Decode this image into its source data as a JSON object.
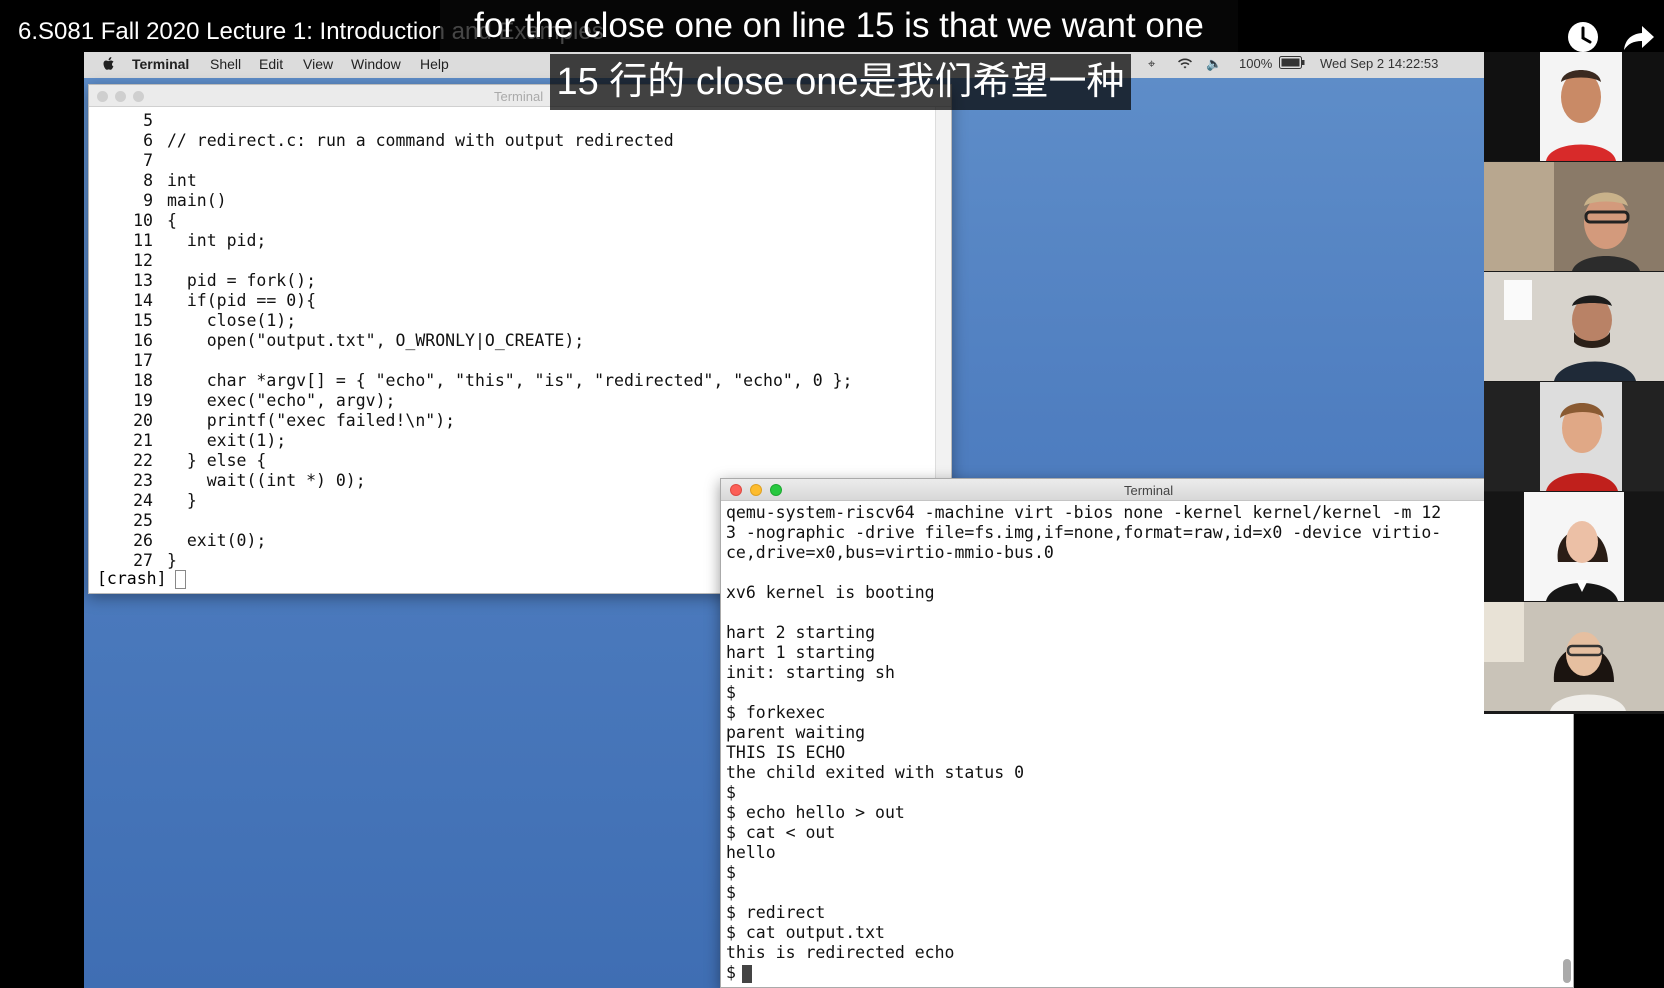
{
  "video": {
    "title": "6.S081 Fall 2020 Lecture 1: Introduction and Examples",
    "icons": [
      "clock-icon",
      "share-icon"
    ]
  },
  "captions": {
    "english": "for the close one on line 15 is that we want one",
    "chinese": "15 行的 close one是我们希望一种"
  },
  "menubar": {
    "apple_icon": "apple-icon",
    "app_name": "Terminal",
    "items": [
      "Shell",
      "Edit",
      "View",
      "Window",
      "Help"
    ],
    "battery": "100%",
    "datetime": "Wed Sep 2  14:22:53"
  },
  "editor": {
    "title": "Terminal",
    "lines": [
      {
        "num": "5",
        "text": ""
      },
      {
        "num": "6",
        "text": "// redirect.c: run a command with output redirected"
      },
      {
        "num": "7",
        "text": ""
      },
      {
        "num": "8",
        "text": "int"
      },
      {
        "num": "9",
        "text": "main()"
      },
      {
        "num": "10",
        "text": "{"
      },
      {
        "num": "11",
        "text": "  int pid;"
      },
      {
        "num": "12",
        "text": ""
      },
      {
        "num": "13",
        "text": "  pid = fork();"
      },
      {
        "num": "14",
        "text": "  if(pid == 0){"
      },
      {
        "num": "15",
        "text": "    close(1);"
      },
      {
        "num": "16",
        "text": "    open(\"output.txt\", O_WRONLY|O_CREATE);"
      },
      {
        "num": "17",
        "text": ""
      },
      {
        "num": "18",
        "text": "    char *argv[] = { \"echo\", \"this\", \"is\", \"redirected\", \"echo\", 0 };"
      },
      {
        "num": "19",
        "text": "    exec(\"echo\", argv);"
      },
      {
        "num": "20",
        "text": "    printf(\"exec failed!\\n\");"
      },
      {
        "num": "21",
        "text": "    exit(1);"
      },
      {
        "num": "22",
        "text": "  } else {"
      },
      {
        "num": "23",
        "text": "    wait((int *) 0);"
      },
      {
        "num": "24",
        "text": "  }"
      },
      {
        "num": "25",
        "text": ""
      },
      {
        "num": "26",
        "text": "  exit(0);"
      },
      {
        "num": "27",
        "text": "}"
      }
    ],
    "status": "[crash]"
  },
  "terminal": {
    "title": "Terminal",
    "lines": [
      "qemu-system-riscv64 -machine virt -bios none -kernel kernel/kernel -m 12",
      "3 -nographic -drive file=fs.img,if=none,format=raw,id=x0 -device virtio-",
      "ce,drive=x0,bus=virtio-mmio-bus.0",
      "",
      "xv6 kernel is booting",
      "",
      "hart 2 starting",
      "hart 1 starting",
      "init: starting sh",
      "$",
      "$ forkexec",
      "parent waiting",
      "THIS IS ECHO",
      "the child exited with status 0",
      "$",
      "$ echo hello > out",
      "$ cat < out",
      "hello",
      "$",
      "$",
      "$ redirect",
      "$ cat output.txt",
      "this is redirected echo",
      "$"
    ]
  },
  "participants": [
    "participant-1",
    "participant-2",
    "participant-3",
    "participant-4",
    "participant-5",
    "participant-6"
  ]
}
